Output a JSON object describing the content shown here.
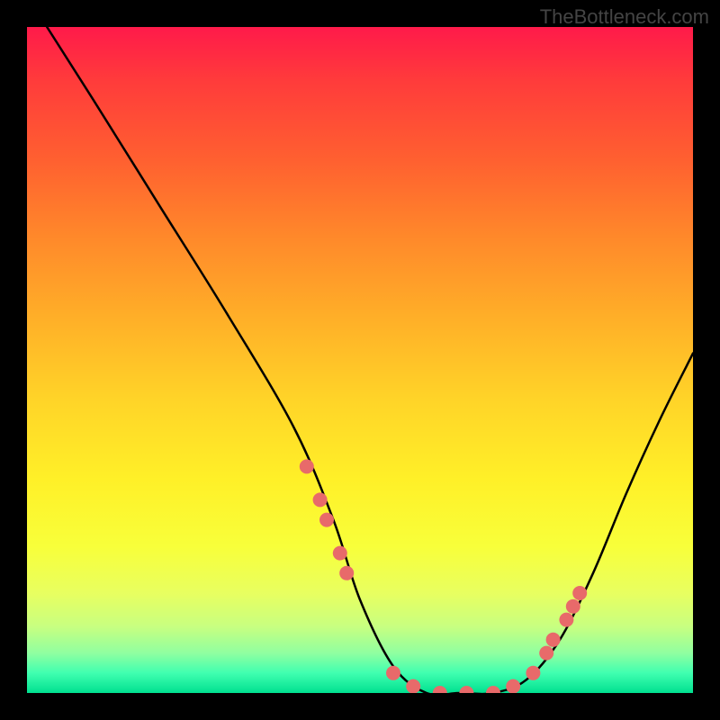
{
  "watermark": "TheBottleneck.com",
  "chart_data": {
    "type": "line",
    "title": "",
    "xlabel": "",
    "ylabel": "",
    "xlim": [
      0,
      100
    ],
    "ylim": [
      0,
      100
    ],
    "series": [
      {
        "name": "bottleneck-curve",
        "x": [
          3,
          10,
          20,
          30,
          40,
          46,
          50,
          55,
          60,
          65,
          70,
          75,
          80,
          85,
          90,
          95,
          100
        ],
        "y": [
          100,
          89,
          73,
          57,
          40,
          26,
          14,
          4,
          0,
          0,
          0,
          2,
          8,
          18,
          30,
          41,
          51
        ]
      }
    ],
    "markers": {
      "name": "highlight-dots",
      "color": "#e86a6a",
      "points": [
        {
          "x": 42,
          "y": 34
        },
        {
          "x": 44,
          "y": 29
        },
        {
          "x": 45,
          "y": 26
        },
        {
          "x": 47,
          "y": 21
        },
        {
          "x": 48,
          "y": 18
        },
        {
          "x": 55,
          "y": 3
        },
        {
          "x": 58,
          "y": 1
        },
        {
          "x": 62,
          "y": 0
        },
        {
          "x": 66,
          "y": 0
        },
        {
          "x": 70,
          "y": 0
        },
        {
          "x": 73,
          "y": 1
        },
        {
          "x": 76,
          "y": 3
        },
        {
          "x": 78,
          "y": 6
        },
        {
          "x": 79,
          "y": 8
        },
        {
          "x": 81,
          "y": 11
        },
        {
          "x": 82,
          "y": 13
        },
        {
          "x": 83,
          "y": 15
        }
      ]
    }
  }
}
